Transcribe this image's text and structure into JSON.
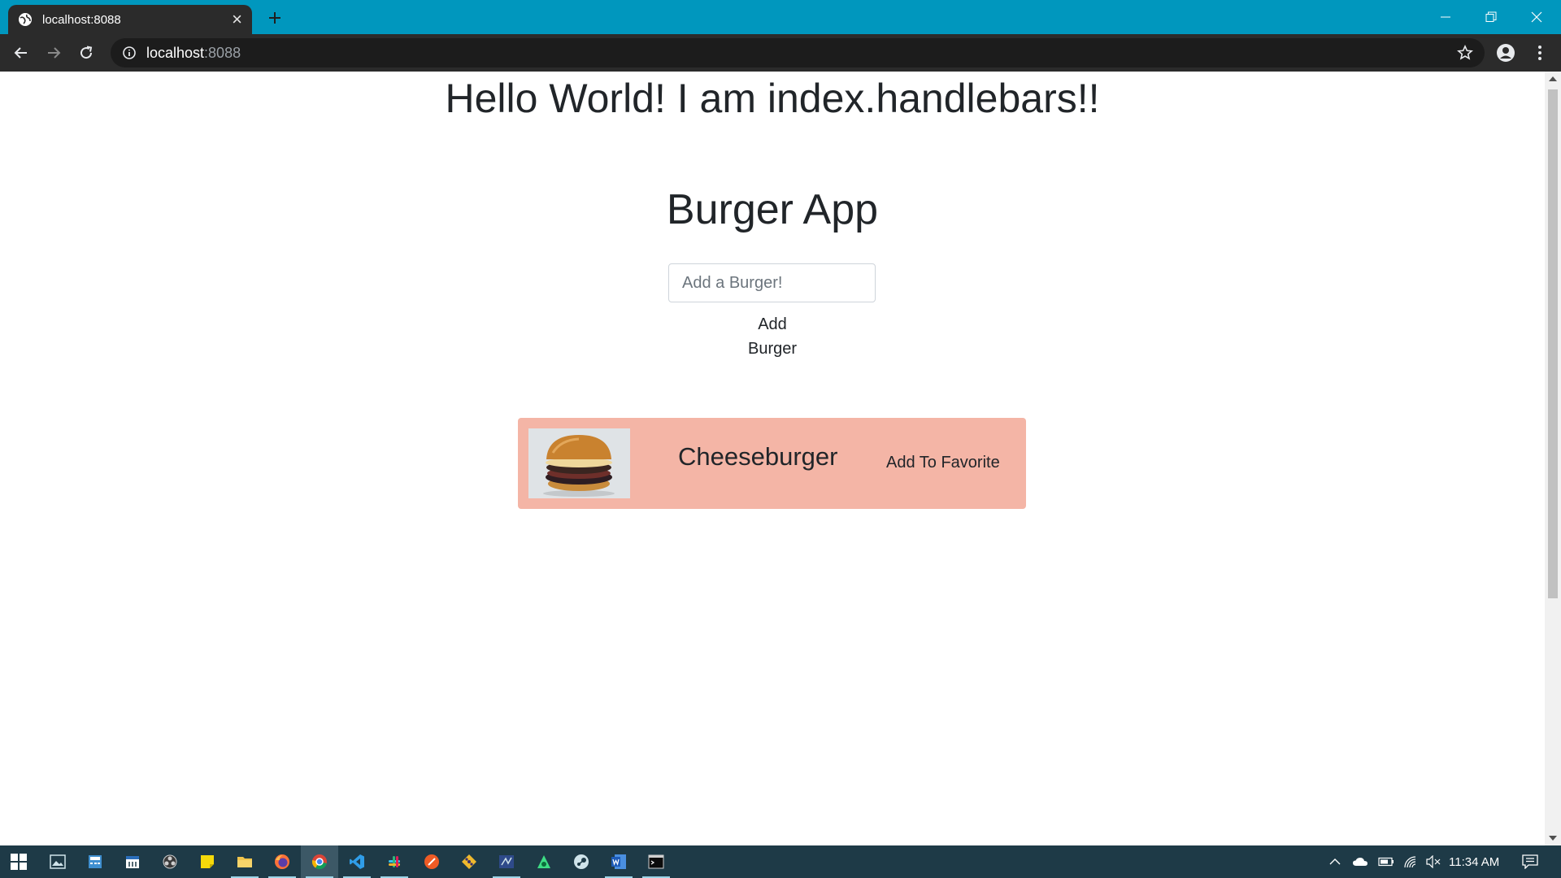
{
  "browser": {
    "tab_title": "localhost:8088",
    "url_host": "localhost",
    "url_port": ":8088"
  },
  "page": {
    "hello_heading": "Hello World! I am index.handlebars!!",
    "app_title": "Burger App",
    "input_placeholder": "Add a Burger!",
    "add_button_line1": "Add",
    "add_button_line2": "Burger",
    "burgers": [
      {
        "name": "Cheeseburger",
        "action_label": "Add To Favorite"
      }
    ]
  },
  "taskbar": {
    "apps": [
      "start",
      "photos",
      "calculator",
      "calendar",
      "obs",
      "sticky-notes",
      "file-explorer",
      "firefox",
      "chrome",
      "vscode",
      "slack",
      "postman",
      "git",
      "ssms",
      "android-studio",
      "steam",
      "word",
      "terminal"
    ],
    "clock": "11:34 AM"
  },
  "colors": {
    "tab_strip": "#0097be",
    "toolbar": "#2b2b2b",
    "card_bg": "#f4b5a6",
    "taskbar": "#1e3a47"
  }
}
